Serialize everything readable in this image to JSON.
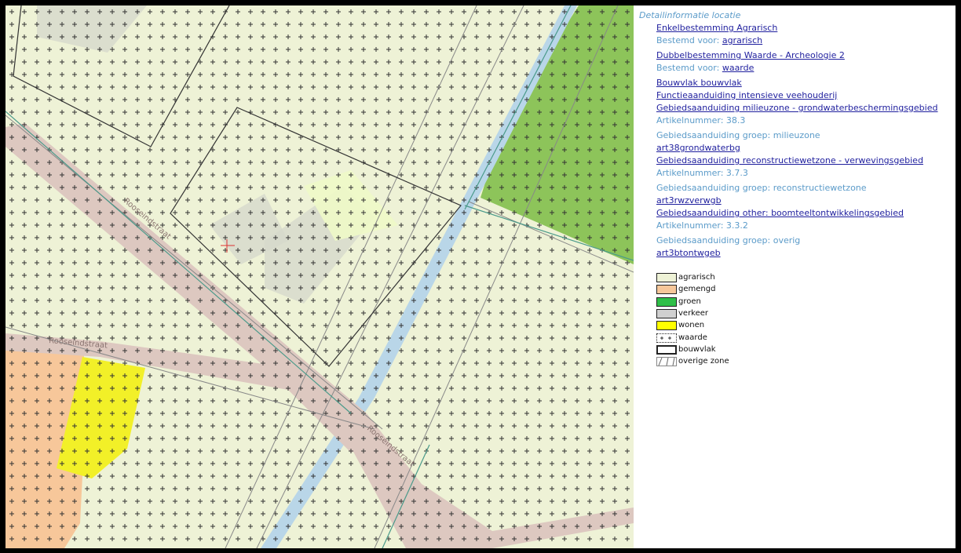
{
  "map": {
    "street_labels": [
      "Rooseindstraat",
      "Rooseindstraat",
      "Rooseindstraat"
    ]
  },
  "info": {
    "title": "Detailinformatie locatie",
    "rows": [
      {
        "type": "link",
        "text": "Enkelbestemming Agrarisch"
      },
      {
        "type": "pair",
        "label": "Bestemd voor: ",
        "link": "agrarisch"
      },
      {
        "type": "link",
        "text": "Dubbelbestemming Waarde - Archeologie 2"
      },
      {
        "type": "pair",
        "label": "Bestemd voor: ",
        "link": "waarde"
      },
      {
        "type": "link",
        "text": "Bouwvlak bouwvlak"
      },
      {
        "type": "link",
        "text": "Functieaanduiding intensieve veehouderij"
      },
      {
        "type": "link",
        "text": "Gebiedsaanduiding milieuzone - grondwaterbeschermingsgebied"
      },
      {
        "type": "label",
        "text": "Artikelnummer: 38.3"
      },
      {
        "type": "label",
        "text": "Gebiedsaanduiding groep: milieuzone"
      },
      {
        "type": "link",
        "text": "art38grondwaterbg"
      },
      {
        "type": "link",
        "text": "Gebiedsaanduiding reconstructiewetzone - verwevingsgebied"
      },
      {
        "type": "label",
        "text": "Artikelnummer: 3.7.3"
      },
      {
        "type": "label",
        "text": "Gebiedsaanduiding groep: reconstructiewetzone"
      },
      {
        "type": "link",
        "text": "art3rwzverwgb"
      },
      {
        "type": "link",
        "text": "Gebiedsaanduiding other: boomteeltontwikkelingsgebied"
      },
      {
        "type": "label",
        "text": "Artikelnummer: 3.3.2"
      },
      {
        "type": "label",
        "text": "Gebiedsaanduiding groep: overig"
      },
      {
        "type": "link",
        "text": "art3btontwgeb"
      }
    ]
  },
  "legend": [
    {
      "label": "agrarisch",
      "swatch": "fill",
      "color": "#eef2d6"
    },
    {
      "label": "gemengd",
      "swatch": "fill",
      "color": "#f7c79a"
    },
    {
      "label": "groen",
      "swatch": "fill",
      "color": "#2fbf48"
    },
    {
      "label": "verkeer",
      "swatch": "fill",
      "color": "#d0d0d0"
    },
    {
      "label": "wonen",
      "swatch": "fill",
      "color": "#ffff00"
    },
    {
      "label": "waarde",
      "swatch": "plus"
    },
    {
      "label": "bouwvlak",
      "swatch": "thick"
    },
    {
      "label": "overige zone",
      "swatch": "hatch"
    }
  ],
  "colors": {
    "agrarisch": "#eef2d6",
    "road": "#ddc8c0",
    "water": "#b9d6e8",
    "groen": "#8dc45a",
    "gemengd": "#f7c79a",
    "wonen": "#f2f028",
    "link": "#1f1f9e",
    "label": "#5b9bc9"
  }
}
